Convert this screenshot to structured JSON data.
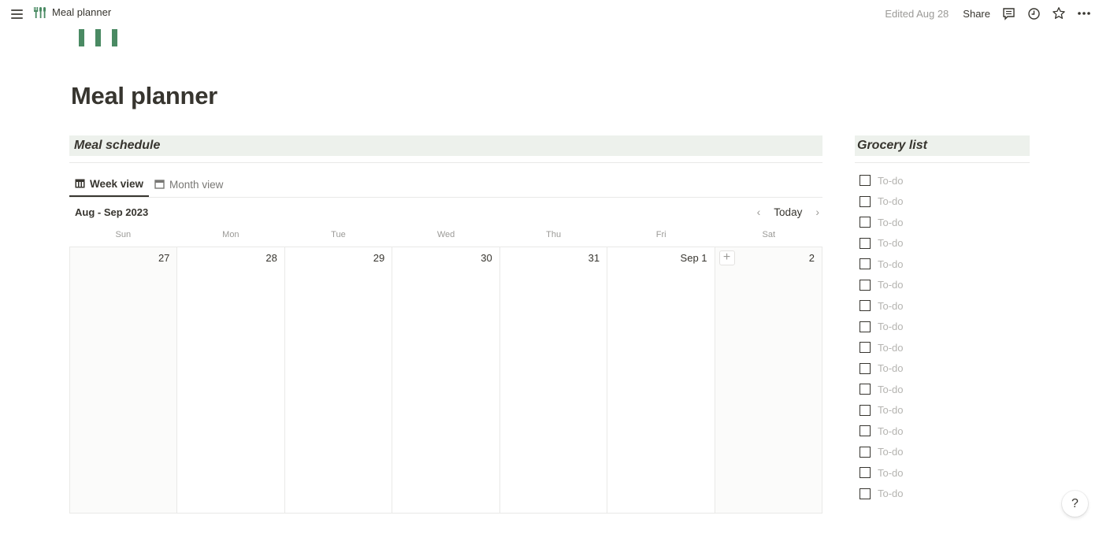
{
  "topbar": {
    "page_name": "Meal planner",
    "edited": "Edited Aug 28",
    "share_label": "Share",
    "icons": [
      "menu-icon",
      "fork-knife-icon",
      "comment-icon",
      "clock-icon",
      "star-icon",
      "more-icon"
    ]
  },
  "page": {
    "title": "Meal planner",
    "accent_color": "#4a8a63"
  },
  "schedule": {
    "header": "Meal schedule",
    "tabs": [
      {
        "label": "Week view",
        "active": true
      },
      {
        "label": "Month view",
        "active": false
      }
    ],
    "range": "Aug - Sep 2023",
    "today_label": "Today",
    "weekdays": [
      "Sun",
      "Mon",
      "Tue",
      "Wed",
      "Thu",
      "Fri",
      "Sat"
    ],
    "days": [
      "27",
      "28",
      "29",
      "30",
      "31",
      "Sep 1",
      "2"
    ],
    "add_label": "+"
  },
  "grocery": {
    "header": "Grocery list",
    "items": [
      "To-do",
      "To-do",
      "To-do",
      "To-do",
      "To-do",
      "To-do",
      "To-do",
      "To-do",
      "To-do",
      "To-do",
      "To-do",
      "To-do",
      "To-do",
      "To-do",
      "To-do",
      "To-do"
    ]
  },
  "help": {
    "label": "?"
  }
}
